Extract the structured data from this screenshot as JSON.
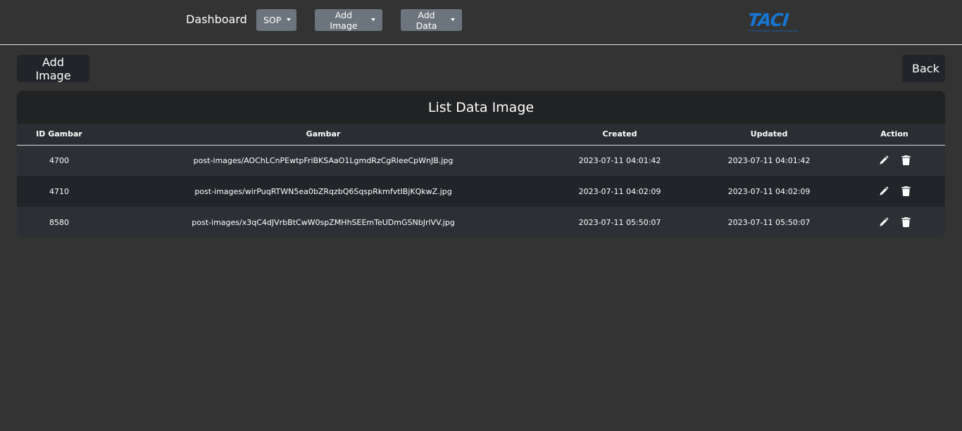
{
  "nav": {
    "brand": "Dashboard",
    "menus": [
      {
        "label": "SOP"
      },
      {
        "label": "Add Image"
      },
      {
        "label": "Add Data"
      }
    ],
    "logo": {
      "text": "TACI",
      "subtext": "PT TD Automotive Compressor Indonesia"
    }
  },
  "toolbar": {
    "add_label": "Add Image",
    "back_label": "Back"
  },
  "table": {
    "title": "List Data Image",
    "columns": [
      "ID Gambar",
      "Gambar",
      "Created",
      "Updated",
      "Action"
    ],
    "rows": [
      {
        "id": "4700",
        "gambar": "post-images/AOChLCnPEwtpFriBKSAaO1LgmdRzCgRleeCpWnJB.jpg",
        "created": "2023-07-11 04:01:42",
        "updated": "2023-07-11 04:01:42"
      },
      {
        "id": "4710",
        "gambar": "post-images/wirPuqRTWN5ea0bZRqzbQ6SqspRkmfvtIBjKQkwZ.jpg",
        "created": "2023-07-11 04:02:09",
        "updated": "2023-07-11 04:02:09"
      },
      {
        "id": "8580",
        "gambar": "post-images/x3qC4dJVrbBtCwW0spZMHhSEEmTeUDmGSNbJrlVV.jpg",
        "created": "2023-07-11 05:50:07",
        "updated": "2023-07-11 05:50:07"
      }
    ],
    "action_icons": [
      "pencil-icon",
      "trash-icon"
    ]
  },
  "colors": {
    "background": "#333333",
    "header": "#212223",
    "row_odd": "#2c3035",
    "row_even": "#212529",
    "menu_button": "#6c757d",
    "logo": "#1676d2"
  }
}
